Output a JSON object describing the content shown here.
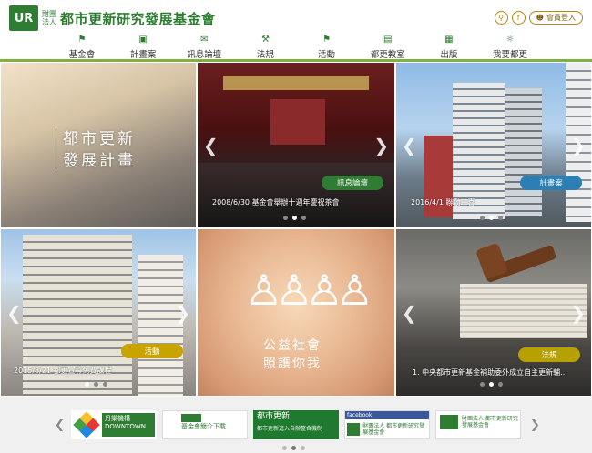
{
  "header": {
    "logo_mark": "UR",
    "logo_small_line1": "財團",
    "logo_small_line2": "法人",
    "title": "都市更新研究發展基金會",
    "search_icon": "search-icon",
    "facebook_icon": "f",
    "login_label": "會員登入"
  },
  "nav": [
    {
      "label": "基金會",
      "icon": "flag-icon"
    },
    {
      "label": "計畫案",
      "icon": "calendar-icon"
    },
    {
      "label": "訊息論壇",
      "icon": "chat-icon"
    },
    {
      "label": "法規",
      "icon": "gavel-icon"
    },
    {
      "label": "活動",
      "icon": "flag-icon"
    },
    {
      "label": "都更教室",
      "icon": "board-icon"
    },
    {
      "label": "出版",
      "icon": "book-icon"
    },
    {
      "label": "我要都更",
      "icon": "lightbulb-icon"
    }
  ],
  "tiles": {
    "t1": {
      "line1": "都市更新",
      "line2": "發展計畫"
    },
    "t2": {
      "tag": "訊息論壇",
      "caption": "2008/6/30 基金會舉辦十週年慶祝茶會"
    },
    "t3": {
      "tag": "計畫案",
      "caption": "2016/4/1 聯勤三喜"
    },
    "t4": {
      "tag": "活動",
      "caption": "2015/8/21 都更宣導免費課程"
    },
    "t5": {
      "line1": "公益社會",
      "line2": "照護你我"
    },
    "t6": {
      "tag": "法規",
      "caption": "1. 中央都市更新基金補助委外成立自主更新輔..."
    }
  },
  "footer": {
    "b1_title": "丹棠機構",
    "b1_sub": "DOWNTOWN",
    "b2_text": "基金會簡介下載",
    "b3_title": "都市更新",
    "b3_sub": "都市更新進入自辦整合機制",
    "b4_fb": "facebook",
    "b4_text": "財團法人 都市更新研究發展基金會",
    "b5_text": "財團法人 都市更新研究發展基金會"
  },
  "colors": {
    "brand_green": "#2e7d32",
    "accent_gold": "#b8860b",
    "nav_underline": "#7cb342"
  }
}
